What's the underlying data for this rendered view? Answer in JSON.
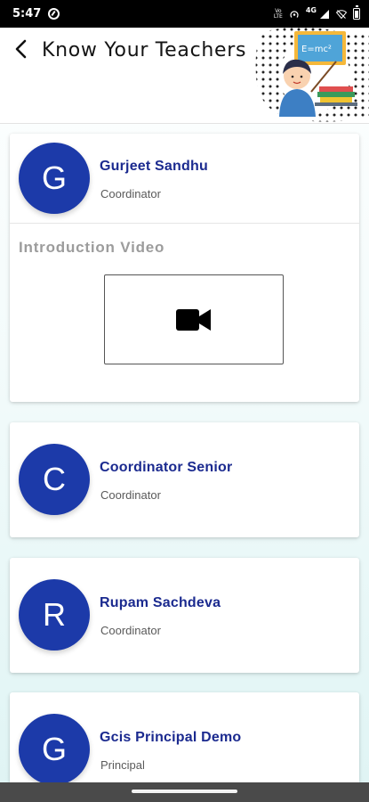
{
  "status_bar": {
    "time": "5:47",
    "volte": [
      "Vo",
      "LTE"
    ],
    "network": "4G"
  },
  "header": {
    "title": "Know Your Teachers",
    "illustration_text": "E=mc²"
  },
  "teachers": [
    {
      "initial": "G",
      "name": "Gurjeet Sandhu",
      "role": "Coordinator"
    },
    {
      "initial": "C",
      "name": "Coordinator Senior",
      "role": "Coordinator"
    },
    {
      "initial": "R",
      "name": "Rupam Sachdeva",
      "role": "Coordinator"
    },
    {
      "initial": "G",
      "name": "Gcis Principal Demo",
      "role": "Principal"
    }
  ],
  "intro_video": {
    "heading": "Introduction Video"
  },
  "colors": {
    "avatar_bg": "#1c3aa9",
    "name_text": "#1b2a8f",
    "status_bar": "#000000"
  },
  "icons": {
    "back": "arrow-left",
    "video": "videocam"
  }
}
